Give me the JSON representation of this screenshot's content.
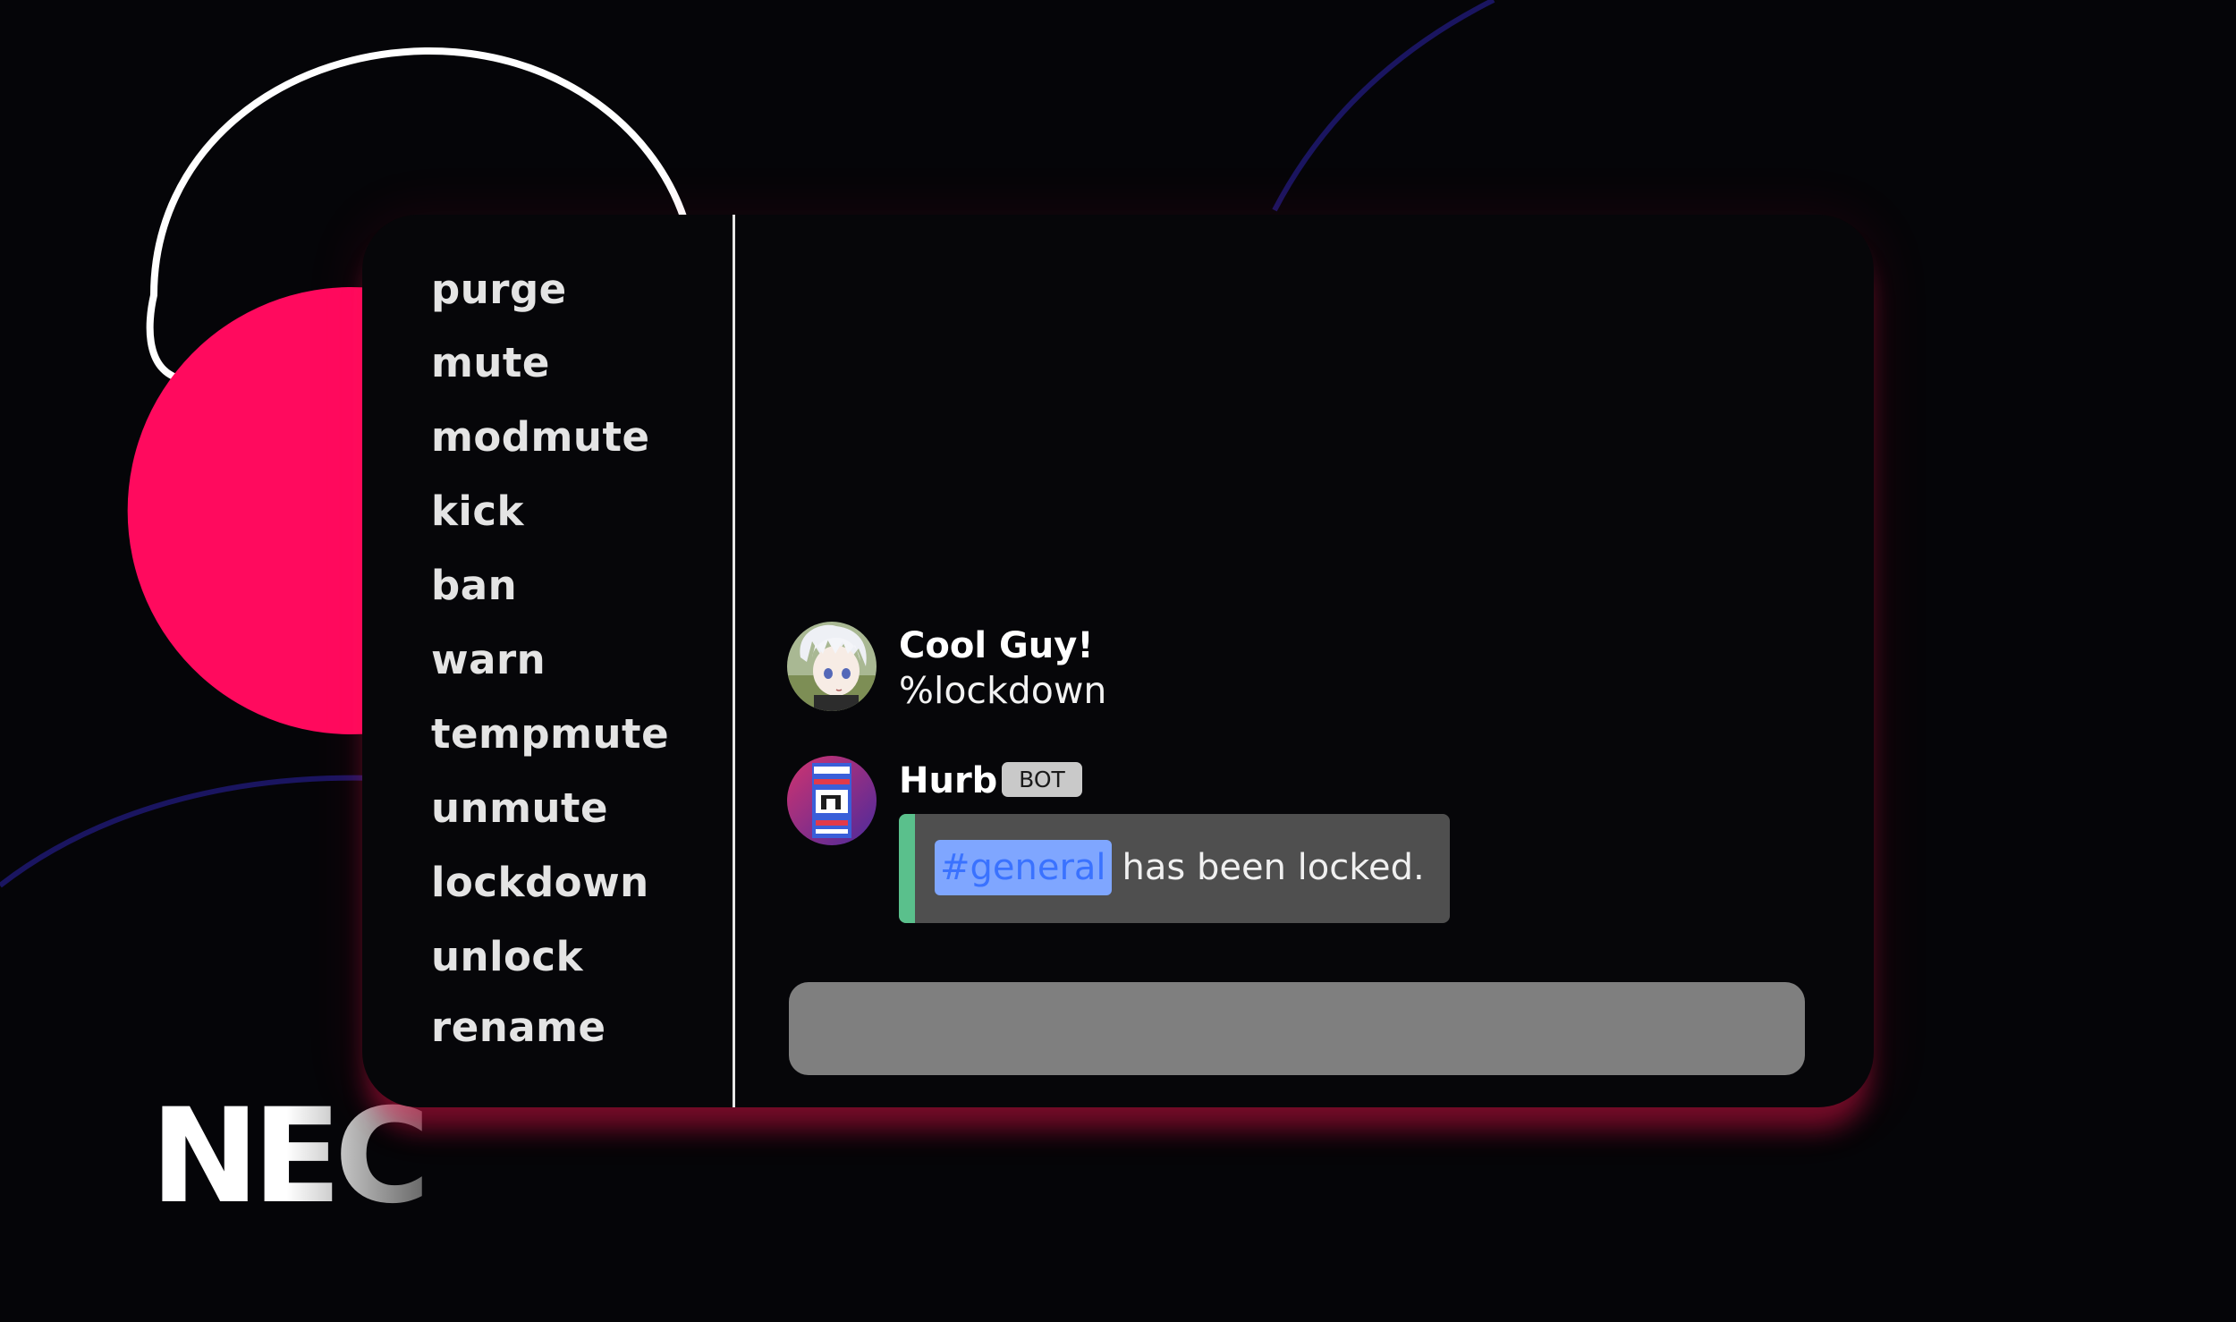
{
  "branding": {
    "logo_text": "NEC"
  },
  "colors": {
    "background": "#050508",
    "accent_pink": "#ff0a5e",
    "outline_white": "#ffffff",
    "line_navy": "#1a1560",
    "window_bg": "#060609",
    "window_glow": "#ff1450",
    "embed_bg": "#4f4f4f",
    "embed_accent": "#5ac08c",
    "mention_bg": "#7fa6ff",
    "mention_text": "#3a72ff",
    "input_bg": "#7f7f7f"
  },
  "sidebar": {
    "commands": [
      {
        "label": "purge"
      },
      {
        "label": "mute"
      },
      {
        "label": "modmute"
      },
      {
        "label": "kick"
      },
      {
        "label": "ban"
      },
      {
        "label": "warn"
      },
      {
        "label": "tempmute"
      },
      {
        "label": "unmute"
      },
      {
        "label": "lockdown"
      },
      {
        "label": "unlock"
      },
      {
        "label": "rename"
      }
    ]
  },
  "chat": {
    "messages": [
      {
        "author": "Cool Guy!",
        "avatar_icon": "anime-character-avatar",
        "text": "%lockdown"
      },
      {
        "author": "Hurb",
        "avatar_icon": "bot-robot-avatar",
        "badge": "BOT",
        "embed": {
          "channel_mention": "#general",
          "text": "has been locked."
        }
      }
    ],
    "input": {
      "placeholder": "",
      "value": ""
    }
  }
}
